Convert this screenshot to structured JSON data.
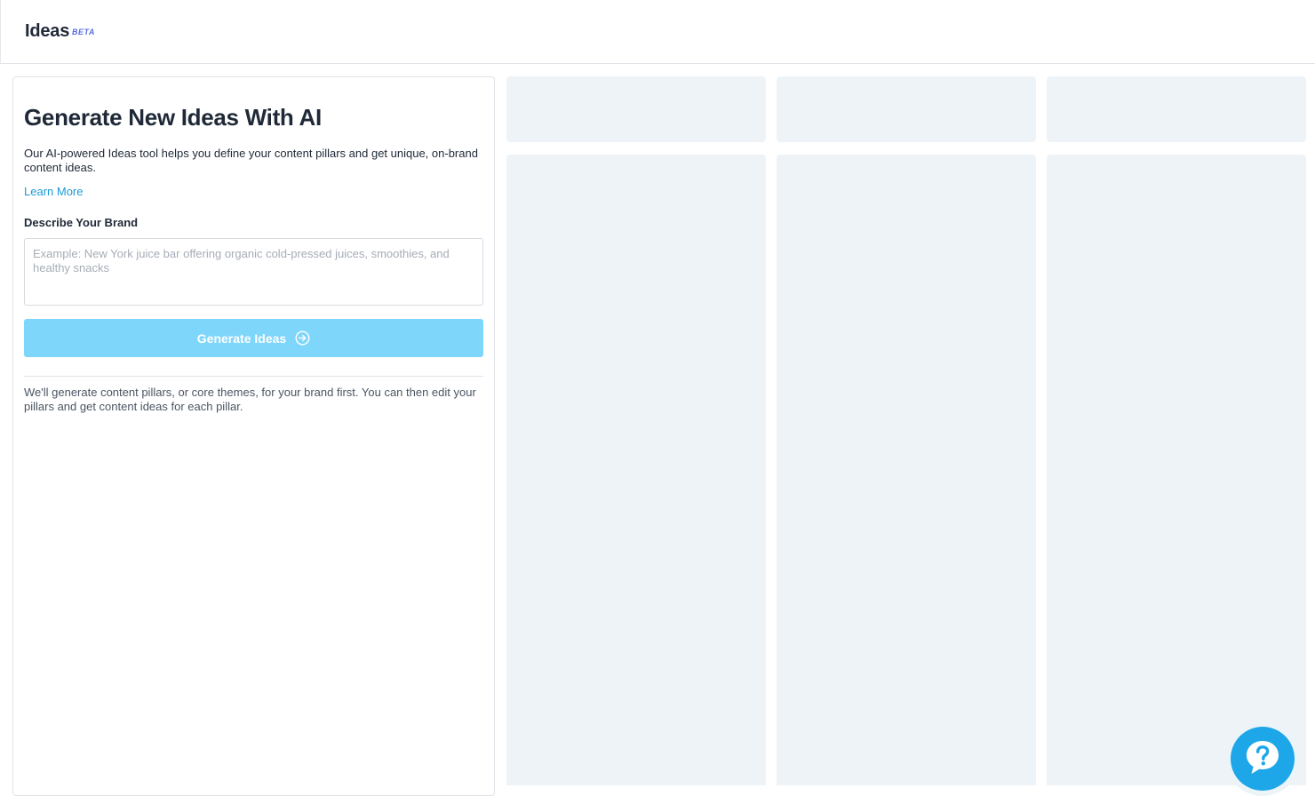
{
  "header": {
    "title": "Ideas",
    "badge": "BETA"
  },
  "panel": {
    "title": "Generate New Ideas With AI",
    "description": "Our AI-powered Ideas tool helps you define your content pillars and get unique, on-brand content ideas.",
    "learn_more": "Learn More",
    "brand_label": "Describe Your Brand",
    "brand_value": "",
    "brand_placeholder": "Example: New York juice bar offering organic cold-pressed juices, smoothies, and healthy snacks",
    "generate_label": "Generate Ideas",
    "footnote": "We'll generate content pillars, or core themes, for your brand first. You can then edit your pillars and get content ideas for each pillar."
  },
  "icons": {
    "generate": "arrow-right-circle-icon",
    "help": "question-chat-icon"
  },
  "colors": {
    "accent": "#1c9ad6",
    "button_disabled": "#7fd6fb",
    "skeleton": "#eef3f7",
    "help": "#1da7e9"
  }
}
